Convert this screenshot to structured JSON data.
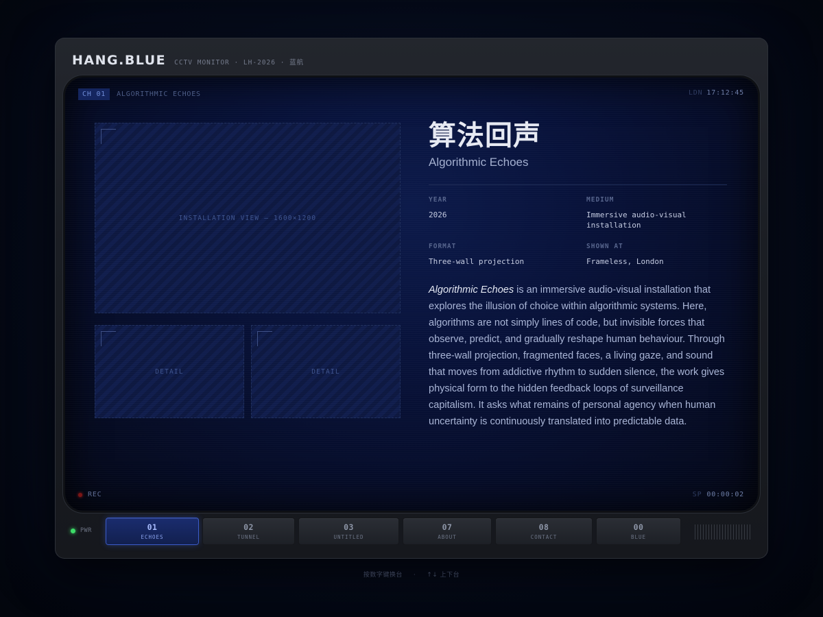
{
  "header": {
    "brand": "HANG.BLUE",
    "subtitle": "CCTV MONITOR · LH-2026 · 蓝航"
  },
  "screen": {
    "channel_badge": "CH 01",
    "channel_title": "ALGORITHMIC ECHOES",
    "location": "LDN",
    "clock": "17:12:45",
    "rec_label": "REC",
    "sp_label": "SP",
    "timecode": "00:00:02"
  },
  "media": {
    "main_label": "INSTALLATION VIEW — 1600×1200",
    "detail1_label": "DETAIL",
    "detail2_label": "DETAIL"
  },
  "project": {
    "title_zh": "算法回声",
    "title_en": "Algorithmic Echoes",
    "meta": {
      "year_label": "YEAR",
      "year": "2026",
      "medium_label": "MEDIUM",
      "medium": "Immersive audio-visual installation",
      "format_label": "FORMAT",
      "format": "Three-wall projection",
      "shown_label": "SHOWN AT",
      "shown": "Frameless, London"
    },
    "desc_title": "Algorithmic Echoes",
    "desc_body": " is an immersive audio-visual installation that explores the illusion of choice within algorithmic systems. Here, algorithms are not simply lines of code, but invisible forces that observe, predict, and gradually reshape human behaviour. Through three-wall projection, fragmented faces, a living gaze, and sound that moves from addictive rhythm to sudden silence, the work gives physical form to the hidden feedback loops of surveillance capitalism. It asks what remains of personal agency when human uncertainty is continuously translated into predictable data."
  },
  "controls": {
    "power_label": "PWR",
    "channels": [
      {
        "num": "01",
        "label": "ECHOES",
        "active": true
      },
      {
        "num": "02",
        "label": "TUNNEL",
        "active": false
      },
      {
        "num": "03",
        "label": "UNTITLED",
        "active": false
      },
      {
        "num": "07",
        "label": "ABOUT",
        "active": false
      },
      {
        "num": "08",
        "label": "CONTACT",
        "active": false
      },
      {
        "num": "00",
        "label": "BLUE",
        "active": false
      }
    ]
  },
  "hint": {
    "left": "按数字键换台",
    "sep": "·",
    "right": "↑↓ 上下台"
  },
  "colors": {
    "accent": "#3b5bc8",
    "power_led": "#3ddc68",
    "rec_dot": "#7a1414",
    "screen_bg": "#08123a"
  }
}
